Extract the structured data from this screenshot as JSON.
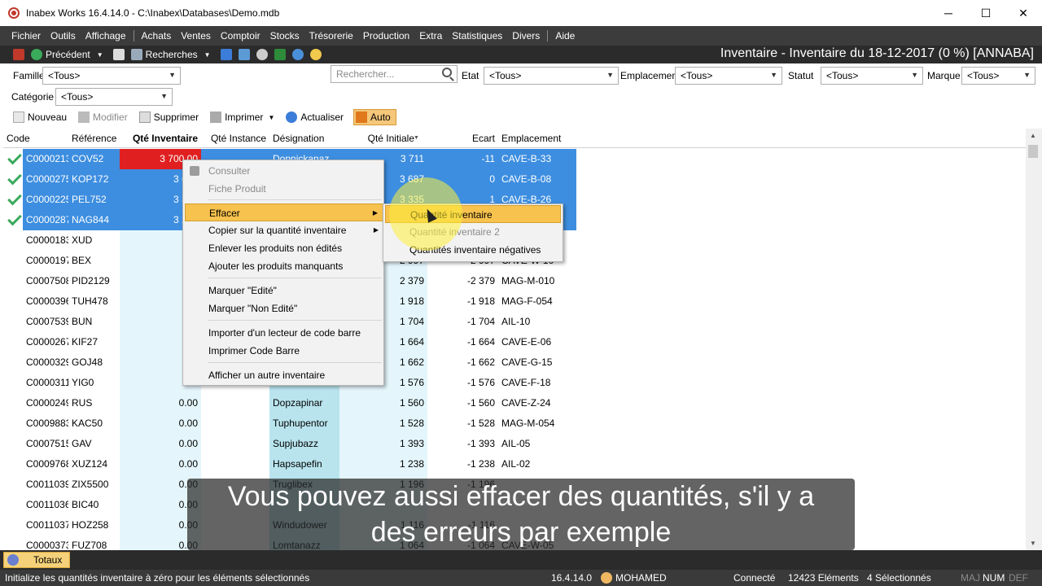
{
  "window": {
    "title": "Inabex Works 16.4.14.0 - C:\\Inabex\\Databases\\Demo.mdb",
    "minimize": "─",
    "maximize": "☐",
    "close": "✕"
  },
  "menu": [
    "Fichier",
    "Outils",
    "Affichage",
    "Achats",
    "Ventes",
    "Comptoir",
    "Stocks",
    "Trésorerie",
    "Production",
    "Extra",
    "Statistiques",
    "Divers",
    "Aide"
  ],
  "toolbar": {
    "previous": "Précédent",
    "search": "Recherches",
    "heading": "Inventaire - Inventaire du 18-12-2017 (0 %) [ANNABA]"
  },
  "filters": {
    "familles_label": "Familles",
    "familles_value": "<Tous>",
    "search_placeholder": "Rechercher...",
    "etat_label": "Etat",
    "etat_value": "<Tous>",
    "emplacement_label": "Emplacement",
    "emplacement_value": "<Tous>",
    "statut_label": "Statut",
    "statut_value": "<Tous>",
    "marque_label": "Marque",
    "marque_value": "<Tous>",
    "categorie_label": "Catégorie",
    "categorie_value": "<Tous>"
  },
  "actions": {
    "new": "Nouveau",
    "edit": "Modifier",
    "delete": "Supprimer",
    "print": "Imprimer",
    "refresh": "Actualiser",
    "auto": "Auto"
  },
  "columns": [
    "Code",
    "Référence",
    "Qté Inventaire",
    "Qté Instance",
    "Désignation",
    "Qté Initiale",
    "Ecart",
    "Emplacement"
  ],
  "rows": [
    {
      "code": "C0000213",
      "ref": "COV52",
      "qinv": "3 700,00",
      "qinst": "",
      "desig": "Dopnickanaz",
      "qinit": "3 711",
      "ecart": "-11",
      "emp": "CAVE-B-33",
      "sel": true,
      "check": true
    },
    {
      "code": "C0000275",
      "ref": "KOP172",
      "qinv": "3 687",
      "qinst": "",
      "desig": "",
      "qinit": "3 687",
      "ecart": "0",
      "emp": "CAVE-B-08",
      "sel": true,
      "check": true
    },
    {
      "code": "C0000225",
      "ref": "PEL752",
      "qinv": "3 336",
      "qinst": "",
      "desig": "",
      "qinit": "3 335",
      "ecart": "1",
      "emp": "CAVE-B-26",
      "sel": true,
      "check": true
    },
    {
      "code": "C0000287",
      "ref": "NAG844",
      "qinv": "3 297",
      "qinst": "",
      "desig": "",
      "qinit": "",
      "ecart": "",
      "emp": "",
      "sel": true,
      "check": true
    },
    {
      "code": "C0000183",
      "ref": "XUD",
      "qinv": "0",
      "qinst": "",
      "desig": "",
      "qinit": "",
      "ecart": "",
      "emp": "",
      "sel": false,
      "check": false
    },
    {
      "code": "C0000197",
      "ref": "BEX",
      "qinv": "0",
      "qinst": "",
      "desig": "",
      "qinit": "2 997",
      "ecart": "-2 997",
      "emp": "CAVE-W-10",
      "sel": false,
      "check": false
    },
    {
      "code": "C0007508",
      "ref": "PID2129",
      "qinv": "0",
      "qinst": "",
      "desig": "",
      "qinit": "2 379",
      "ecart": "-2 379",
      "emp": "MAG-M-010",
      "sel": false,
      "check": false
    },
    {
      "code": "C0000396",
      "ref": "TUH478",
      "qinv": "0",
      "qinst": "",
      "desig": "",
      "qinit": "1 918",
      "ecart": "-1 918",
      "emp": "MAG-F-054",
      "sel": false,
      "check": false
    },
    {
      "code": "C0007539",
      "ref": "BUN",
      "qinv": "0",
      "qinst": "",
      "desig": "",
      "qinit": "1 704",
      "ecart": "-1 704",
      "emp": "AIL-10",
      "sel": false,
      "check": false
    },
    {
      "code": "C0000267",
      "ref": "KIF27",
      "qinv": "0",
      "qinst": "",
      "desig": "",
      "qinit": "1 664",
      "ecart": "-1 664",
      "emp": "CAVE-E-06",
      "sel": false,
      "check": false
    },
    {
      "code": "C0000329",
      "ref": "GOJ48",
      "qinv": "0",
      "qinst": "",
      "desig": "",
      "qinit": "1 662",
      "ecart": "-1 662",
      "emp": "CAVE-G-15",
      "sel": false,
      "check": false
    },
    {
      "code": "C0000311",
      "ref": "YIG0",
      "qinv": "0",
      "qinst": "",
      "desig": "",
      "qinit": "1 576",
      "ecart": "-1 576",
      "emp": "CAVE-F-18",
      "sel": false,
      "check": false
    },
    {
      "code": "C0000249",
      "ref": "RUS",
      "qinv": "0.00",
      "qinst": "",
      "desig": "Dopzapinar",
      "qinit": "1 560",
      "ecart": "-1 560",
      "emp": "CAVE-Z-24",
      "sel": false,
      "check": false
    },
    {
      "code": "C0009883",
      "ref": "KAC50",
      "qinv": "0.00",
      "qinst": "",
      "desig": "Tuphupentor",
      "qinit": "1 528",
      "ecart": "-1 528",
      "emp": "MAG-M-054",
      "sel": false,
      "check": false
    },
    {
      "code": "C0007515",
      "ref": "GAV",
      "qinv": "0.00",
      "qinst": "",
      "desig": "Supjubazz",
      "qinit": "1 393",
      "ecart": "-1 393",
      "emp": "AIL-05",
      "sel": false,
      "check": false
    },
    {
      "code": "C0009768",
      "ref": "XUZ124",
      "qinv": "0.00",
      "qinst": "",
      "desig": "Hapsapefin",
      "qinit": "1 238",
      "ecart": "-1 238",
      "emp": "AIL-02",
      "sel": false,
      "check": false
    },
    {
      "code": "C0011039",
      "ref": "ZIX5500",
      "qinv": "0.00",
      "qinst": "",
      "desig": "Truglibex",
      "qinit": "1 196",
      "ecart": "-1 196",
      "emp": "",
      "sel": false,
      "check": false
    },
    {
      "code": "C0011036",
      "ref": "BIC40",
      "qinv": "0.00",
      "qinst": "",
      "desig": "",
      "qinit": "",
      "ecart": "",
      "emp": "",
      "sel": false,
      "check": false
    },
    {
      "code": "C0011037",
      "ref": "HOZ258",
      "qinv": "0.00",
      "qinst": "",
      "desig": "Windudower",
      "qinit": "1 116",
      "ecart": "-1 116",
      "emp": "",
      "sel": false,
      "check": false
    },
    {
      "code": "C0000373",
      "ref": "FUZ708",
      "qinv": "0.00",
      "qinst": "",
      "desig": "Lomtanazz",
      "qinit": "1 064",
      "ecart": "-1 064",
      "emp": "CAVE-W-05",
      "sel": false,
      "check": false
    }
  ],
  "context_menu": [
    "Consulter",
    "Fiche Produit",
    "Effacer",
    "Copier sur la quantité inventaire",
    "Enlever les produits non édités",
    "Ajouter les produits manquants",
    "Marquer  \"Edité\"",
    "Marquer \"Non Edité\"",
    "Importer d'un lecteur de code barre",
    "Imprimer Code Barre",
    "Afficher un autre inventaire"
  ],
  "submenu": [
    "Quantité inventaire",
    "Quantité inventaire 2",
    "Quantités inventaire négatives"
  ],
  "totaux": "Totaux",
  "status": {
    "hint": "Initialize les quantités inventaire à zéro pour les éléments sélectionnés",
    "version": "16.4.14.0",
    "user": "MOHAMED",
    "connected": "Connecté",
    "count": "12423 Eléments",
    "selected": "4 Sélectionnés",
    "maj": "MAJ",
    "num": "NUM",
    "def": "DEF"
  },
  "caption_lines": [
    "Vous pouvez aussi effacer des quantités, s'il y a",
    "des erreurs par exemple"
  ],
  "colors": {
    "selected": "#3d8ee0",
    "qinv_highlight": "#e02020",
    "light_cyan": "#e4f6fb",
    "desig_cyan": "#b9e4ee",
    "accent": "#f7c24d"
  }
}
